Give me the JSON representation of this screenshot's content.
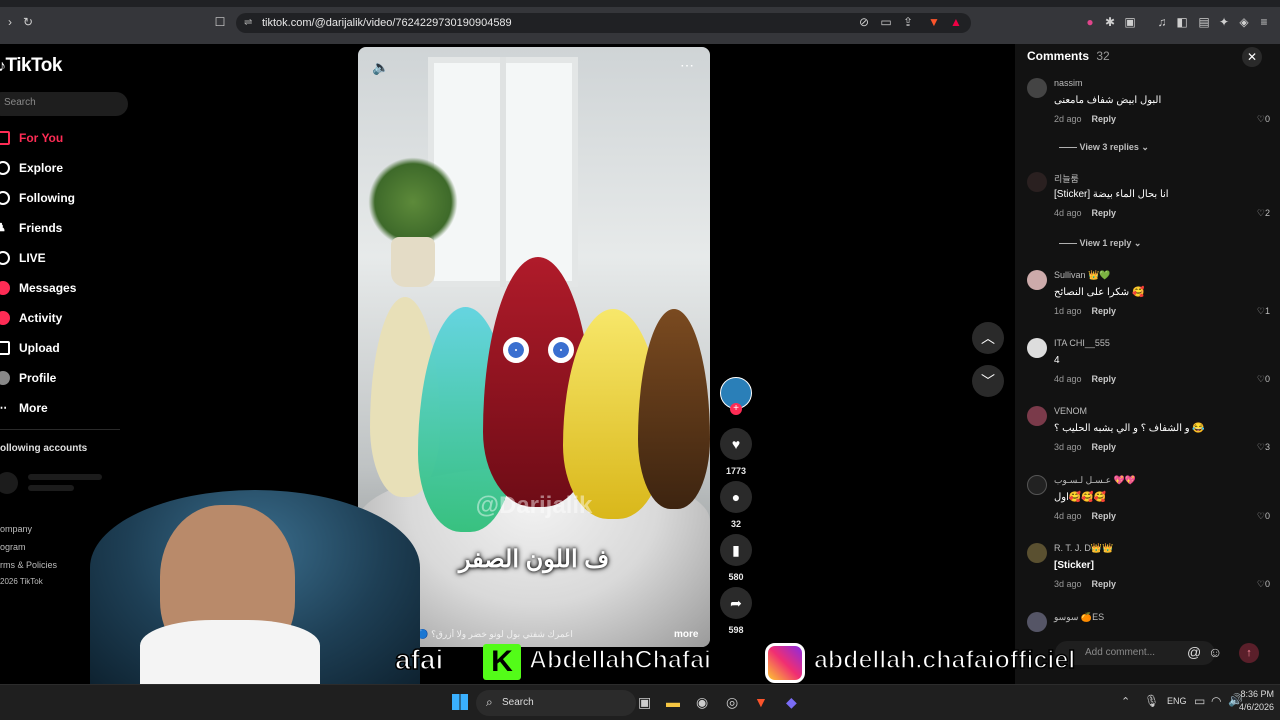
{
  "browser": {
    "url": "tiktok.com/@darijalik/video/7624229730190904589"
  },
  "sidebar": {
    "logo": "TikTok",
    "search_placeholder": "Search",
    "nav": [
      {
        "label": "For You",
        "icon": "home-icon",
        "active": true
      },
      {
        "label": "Explore",
        "icon": "compass-icon"
      },
      {
        "label": "Following",
        "icon": "following-icon"
      },
      {
        "label": "Friends",
        "icon": "friends-icon"
      },
      {
        "label": "LIVE",
        "icon": "live-icon"
      },
      {
        "label": "Messages",
        "icon": "messages-icon"
      },
      {
        "label": "Activity",
        "icon": "activity-icon"
      },
      {
        "label": "Upload",
        "icon": "upload-icon"
      },
      {
        "label": "Profile",
        "icon": "profile-icon"
      },
      {
        "label": "More",
        "icon": "more-icon"
      }
    ],
    "following_title": "ollowing accounts",
    "footer": [
      "ompany",
      "ogram",
      "rms & Policies",
      "2026 TikTok"
    ]
  },
  "video": {
    "watermark": "@Darijalik",
    "caption": "ف اللون الصفر",
    "author": "darijalik",
    "description": "...اعمرك شفتي بول لونو خضر ولا أزرق؟ 🔵🟢 راه بصح",
    "more": "more"
  },
  "actions": {
    "likes": "1773",
    "comments": "32",
    "saves": "580",
    "shares": "598"
  },
  "comments_panel": {
    "title": "Comments",
    "count": "32",
    "input_placeholder": "Add comment...",
    "items": [
      {
        "user": "nassim",
        "text": "البول ابيض شفاف مامعنى",
        "age": "2d ago",
        "reply": "Reply",
        "likes": "0",
        "view_replies": "View 3 replies"
      },
      {
        "user": "리늘룸",
        "text": "[Sticker] انا بحال الماء بيضة",
        "age": "4d ago",
        "reply": "Reply",
        "likes": "2",
        "view_replies": "View 1 reply"
      },
      {
        "user": "Sullivan 👑💚",
        "text": "شكرا على النصائح 🥰",
        "age": "1d ago",
        "reply": "Reply",
        "likes": "1"
      },
      {
        "user": "ITA CHI__555",
        "text": "4",
        "age": "4d ago",
        "reply": "Reply",
        "likes": "0"
      },
      {
        "user": "VENOM",
        "text": "و الشفاف ؟ و الي يشبه الحليب ؟ 😂",
        "age": "3d ago",
        "reply": "Reply",
        "likes": "3"
      },
      {
        "user": "عـسـل لـسـوب 💖💖",
        "text": "اول🥰🥰🥰",
        "age": "4d ago",
        "reply": "Reply",
        "likes": "0"
      },
      {
        "user": "R. T. J. D👑👑",
        "text": "[Sticker]",
        "age": "3d ago",
        "reply": "Reply",
        "likes": "0"
      },
      {
        "user": "سوسو 🍊ES",
        "text": "",
        "age": "",
        "reply": "",
        "likes": ""
      }
    ]
  },
  "banner": {
    "left_text": "afai",
    "kick_handle": "AbdellahChafai",
    "instagram_handle": "abdellah.chafaiofficiel"
  },
  "taskbar": {
    "search": "Search",
    "lang": "ENG",
    "time": "8:36 PM",
    "date": "4/6/2026"
  },
  "colors": {
    "accent": "#fe2c55",
    "kick_green": "#53fc18"
  }
}
